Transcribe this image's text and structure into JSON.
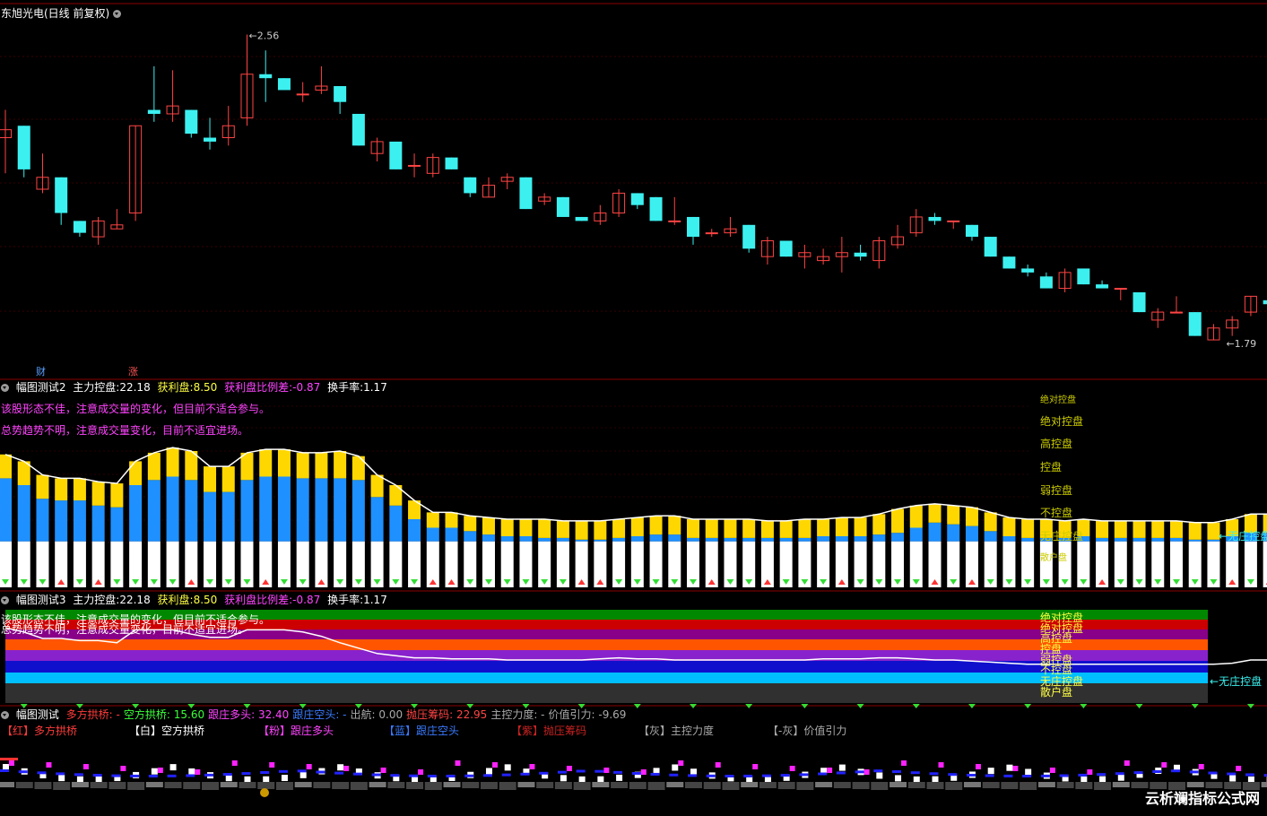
{
  "stock": {
    "title": "东旭光电(日线 前复权)",
    "high_label": "2.56",
    "low_label": "1.79",
    "markers": [
      "财",
      "涨"
    ]
  },
  "panel2": {
    "name": "幅图测试2",
    "items": [
      {
        "label": "主力控盘:",
        "value": "22.18"
      },
      {
        "label": "获利盘:",
        "value": "8.50"
      },
      {
        "label": "获利盘比例差:",
        "value": "-0.87"
      },
      {
        "label": "换手率:",
        "value": "1.17"
      }
    ],
    "comment1": "该股形态不佳，注意成交量的变化，但目前不适合参与。",
    "comment2": "总势趋势不明，注意成交量变化，目前不适宜进场。",
    "levels": [
      "绝对控盘",
      "绝对控盘",
      "高控盘",
      "控盘",
      "弱控盘",
      "不控盘",
      "无庄控盘",
      "散户盘"
    ],
    "current_level": "无庄控盘"
  },
  "panel3": {
    "name": "幅图测试3",
    "items": [
      {
        "label": "主力控盘:",
        "value": "22.18"
      },
      {
        "label": "获利盘:",
        "value": "8.50"
      },
      {
        "label": "获利盘比例差:",
        "value": "-0.87"
      },
      {
        "label": "换手率:",
        "value": "1.17"
      }
    ],
    "comment1": "该股形态不佳，注意成交量的变化，但目前不适合参与。",
    "comment2": "总势趋势不明，注意成交量变化，目前不适宜进场。",
    "levels": [
      "绝对控盘",
      "绝对控盘",
      "高控盘",
      "控盘",
      "弱控盘",
      "不控盘",
      "无庄控盘",
      "散户盘"
    ],
    "current_level": "无庄控盘"
  },
  "panel4": {
    "name": "幅图测试",
    "items": [
      {
        "label": "多方拱桥:",
        "value": "-",
        "color": "#ff3b3b"
      },
      {
        "label": "空方拱桥:",
        "value": "15.60",
        "color": "#3cff3c"
      },
      {
        "label": "跟庄多头:",
        "value": "32.40",
        "color": "#ff44ff"
      },
      {
        "label": "跟庄空头:",
        "value": "-",
        "color": "#3a7bff"
      },
      {
        "label": "出航:",
        "value": "0.00",
        "color": "#aaaaaa"
      },
      {
        "label": "抛压筹码:",
        "value": "22.95",
        "color": "#ff4444"
      },
      {
        "label": "主控力度:",
        "value": "-",
        "color": "#aaaaaa"
      },
      {
        "label": "价值引力:",
        "value": "-9.69",
        "color": "#aaaaaa"
      }
    ],
    "legend": [
      {
        "text": "【红】多方拱桥",
        "color": "#ff3b3b"
      },
      {
        "text": "【白】空方拱桥",
        "color": "#ffffff"
      },
      {
        "text": "【粉】跟庄多头",
        "color": "#ff44ff"
      },
      {
        "text": "【蓝】跟庄空头",
        "color": "#3a7bff"
      },
      {
        "text": "【紫】抛压筹码",
        "color": "#cc2222"
      },
      {
        "text": "【灰】主控力度",
        "color": "#aaaaaa"
      },
      {
        "text": "【-灰】价值引力",
        "color": "#aaaaaa"
      }
    ]
  },
  "colors": {
    "up": "#ff4444",
    "down": "#3cf0f0",
    "divider": "#8b0000"
  },
  "watermark": "云析斓指标公式网",
  "chart_data": {
    "type": "candlestick",
    "ylim": [
      1.72,
      2.62
    ],
    "candles": [
      {
        "o": 2.3,
        "h": 2.37,
        "l": 2.21,
        "c": 2.32
      },
      {
        "o": 2.33,
        "h": 2.33,
        "l": 2.2,
        "c": 2.22
      },
      {
        "o": 2.17,
        "h": 2.26,
        "l": 2.16,
        "c": 2.2
      },
      {
        "o": 2.2,
        "h": 2.2,
        "l": 2.08,
        "c": 2.11
      },
      {
        "o": 2.09,
        "h": 2.09,
        "l": 2.05,
        "c": 2.06
      },
      {
        "o": 2.05,
        "h": 2.1,
        "l": 2.03,
        "c": 2.09
      },
      {
        "o": 2.07,
        "h": 2.12,
        "l": 2.07,
        "c": 2.08
      },
      {
        "o": 2.11,
        "h": 2.33,
        "l": 2.09,
        "c": 2.33
      },
      {
        "o": 2.37,
        "h": 2.48,
        "l": 2.34,
        "c": 2.36
      },
      {
        "o": 2.36,
        "h": 2.47,
        "l": 2.34,
        "c": 2.38
      },
      {
        "o": 2.37,
        "h": 2.37,
        "l": 2.3,
        "c": 2.31
      },
      {
        "o": 2.3,
        "h": 2.35,
        "l": 2.27,
        "c": 2.29
      },
      {
        "o": 2.3,
        "h": 2.38,
        "l": 2.28,
        "c": 2.33
      },
      {
        "o": 2.35,
        "h": 2.56,
        "l": 2.33,
        "c": 2.46
      },
      {
        "o": 2.46,
        "h": 2.52,
        "l": 2.39,
        "c": 2.45
      },
      {
        "o": 2.45,
        "h": 2.45,
        "l": 2.42,
        "c": 2.42
      },
      {
        "o": 2.41,
        "h": 2.44,
        "l": 2.39,
        "c": 2.41
      },
      {
        "o": 2.42,
        "h": 2.48,
        "l": 2.41,
        "c": 2.43
      },
      {
        "o": 2.43,
        "h": 2.43,
        "l": 2.36,
        "c": 2.39
      },
      {
        "o": 2.36,
        "h": 2.36,
        "l": 2.28,
        "c": 2.28
      },
      {
        "o": 2.26,
        "h": 2.3,
        "l": 2.24,
        "c": 2.29
      },
      {
        "o": 2.29,
        "h": 2.29,
        "l": 2.22,
        "c": 2.22
      },
      {
        "o": 2.23,
        "h": 2.26,
        "l": 2.2,
        "c": 2.23
      },
      {
        "o": 2.21,
        "h": 2.26,
        "l": 2.2,
        "c": 2.25
      },
      {
        "o": 2.25,
        "h": 2.25,
        "l": 2.22,
        "c": 2.22
      },
      {
        "o": 2.2,
        "h": 2.2,
        "l": 2.15,
        "c": 2.16
      },
      {
        "o": 2.15,
        "h": 2.2,
        "l": 2.15,
        "c": 2.18
      },
      {
        "o": 2.19,
        "h": 2.21,
        "l": 2.17,
        "c": 2.2
      },
      {
        "o": 2.2,
        "h": 2.2,
        "l": 2.12,
        "c": 2.12
      },
      {
        "o": 2.14,
        "h": 2.16,
        "l": 2.13,
        "c": 2.15
      },
      {
        "o": 2.15,
        "h": 2.15,
        "l": 2.1,
        "c": 2.1
      },
      {
        "o": 2.1,
        "h": 2.1,
        "l": 2.09,
        "c": 2.09
      },
      {
        "o": 2.09,
        "h": 2.13,
        "l": 2.08,
        "c": 2.11
      },
      {
        "o": 2.11,
        "h": 2.17,
        "l": 2.1,
        "c": 2.16
      },
      {
        "o": 2.16,
        "h": 2.16,
        "l": 2.12,
        "c": 2.13
      },
      {
        "o": 2.15,
        "h": 2.15,
        "l": 2.09,
        "c": 2.09
      },
      {
        "o": 2.09,
        "h": 2.15,
        "l": 2.08,
        "c": 2.09
      },
      {
        "o": 2.1,
        "h": 2.1,
        "l": 2.03,
        "c": 2.05
      },
      {
        "o": 2.06,
        "h": 2.07,
        "l": 2.05,
        "c": 2.06
      },
      {
        "o": 2.06,
        "h": 2.1,
        "l": 2.05,
        "c": 2.07
      },
      {
        "o": 2.08,
        "h": 2.08,
        "l": 2.01,
        "c": 2.02
      },
      {
        "o": 2.0,
        "h": 2.05,
        "l": 1.98,
        "c": 2.04
      },
      {
        "o": 2.04,
        "h": 2.04,
        "l": 2.0,
        "c": 2.0
      },
      {
        "o": 2.0,
        "h": 2.03,
        "l": 1.97,
        "c": 2.01
      },
      {
        "o": 1.99,
        "h": 2.02,
        "l": 1.98,
        "c": 2.0
      },
      {
        "o": 2.0,
        "h": 2.05,
        "l": 1.96,
        "c": 2.01
      },
      {
        "o": 2.01,
        "h": 2.03,
        "l": 1.99,
        "c": 2.0
      },
      {
        "o": 1.99,
        "h": 2.05,
        "l": 1.97,
        "c": 2.04
      },
      {
        "o": 2.03,
        "h": 2.08,
        "l": 2.02,
        "c": 2.05
      },
      {
        "o": 2.06,
        "h": 2.12,
        "l": 2.05,
        "c": 2.1
      },
      {
        "o": 2.1,
        "h": 2.11,
        "l": 2.08,
        "c": 2.09
      },
      {
        "o": 2.09,
        "h": 2.09,
        "l": 2.07,
        "c": 2.09
      },
      {
        "o": 2.08,
        "h": 2.08,
        "l": 2.04,
        "c": 2.05
      },
      {
        "o": 2.05,
        "h": 2.05,
        "l": 2.0,
        "c": 2.0
      },
      {
        "o": 2.0,
        "h": 2.0,
        "l": 1.97,
        "c": 1.97
      },
      {
        "o": 1.97,
        "h": 1.98,
        "l": 1.95,
        "c": 1.96
      },
      {
        "o": 1.95,
        "h": 1.96,
        "l": 1.92,
        "c": 1.92
      },
      {
        "o": 1.92,
        "h": 1.97,
        "l": 1.91,
        "c": 1.96
      },
      {
        "o": 1.97,
        "h": 1.97,
        "l": 1.93,
        "c": 1.93
      },
      {
        "o": 1.93,
        "h": 1.94,
        "l": 1.92,
        "c": 1.92
      },
      {
        "o": 1.92,
        "h": 1.92,
        "l": 1.89,
        "c": 1.92
      },
      {
        "o": 1.91,
        "h": 1.91,
        "l": 1.86,
        "c": 1.86
      },
      {
        "o": 1.84,
        "h": 1.87,
        "l": 1.82,
        "c": 1.86
      },
      {
        "o": 1.86,
        "h": 1.9,
        "l": 1.86,
        "c": 1.86
      },
      {
        "o": 1.86,
        "h": 1.86,
        "l": 1.8,
        "c": 1.8
      },
      {
        "o": 1.79,
        "h": 1.83,
        "l": 1.79,
        "c": 1.82
      },
      {
        "o": 1.82,
        "h": 1.85,
        "l": 1.8,
        "c": 1.84
      },
      {
        "o": 1.86,
        "h": 1.9,
        "l": 1.85,
        "c": 1.9
      },
      {
        "o": 1.89,
        "h": 1.91,
        "l": 1.87,
        "c": 1.88
      }
    ],
    "control_index": [
      64,
      60,
      52,
      51,
      51,
      48,
      47,
      60,
      63,
      65,
      63,
      56,
      56,
      63,
      65,
      65,
      64,
      64,
      64,
      63,
      53,
      48,
      40,
      35,
      35,
      33,
      31,
      30,
      30,
      29,
      29,
      28,
      28,
      29,
      30,
      31,
      31,
      29,
      29,
      29,
      29,
      29,
      29,
      29,
      30,
      30,
      30,
      31,
      32,
      35,
      38,
      37,
      36,
      33,
      30,
      29,
      29,
      29,
      30,
      29,
      29,
      29,
      29,
      29,
      28,
      28,
      30,
      32,
      32
    ],
    "upper_band": [
      82,
      78,
      70,
      68,
      68,
      66,
      65,
      78,
      83,
      86,
      84,
      75,
      75,
      83,
      85,
      85,
      83,
      83,
      84,
      81,
      70,
      64,
      55,
      48,
      48,
      46,
      45,
      44,
      44,
      44,
      43,
      43,
      43,
      44,
      45,
      46,
      46,
      44,
      44,
      44,
      44,
      43,
      43,
      44,
      44,
      45,
      45,
      47,
      50,
      52,
      53,
      52,
      51,
      48,
      45,
      44,
      44,
      43,
      44,
      43,
      43,
      43,
      43,
      43,
      42,
      42,
      44,
      47,
      47
    ],
    "line3": [
      64,
      60,
      54,
      54,
      52,
      52,
      50,
      62,
      62,
      62,
      58,
      55,
      55,
      62,
      62,
      62,
      60,
      56,
      50,
      45,
      40,
      38,
      36,
      36,
      35,
      35,
      35,
      34,
      34,
      34,
      34,
      34,
      35,
      36,
      35,
      35,
      34,
      34,
      34,
      34,
      34,
      34,
      34,
      34,
      35,
      35,
      35,
      36,
      36,
      35,
      34,
      34,
      33,
      32,
      31,
      30,
      30,
      30,
      30,
      30,
      30,
      30,
      30,
      30,
      30,
      30,
      31,
      34,
      34
    ]
  }
}
